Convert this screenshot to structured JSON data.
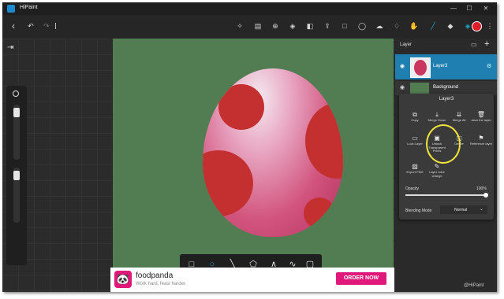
{
  "window": {
    "title": "HiPaint"
  },
  "toolbar": {
    "accent": "#1fa3c9",
    "color_swatch": "#e01e2a",
    "icons": [
      "back-arrow-icon",
      "undo-icon",
      "redo-icon",
      "wand-icon",
      "save-icon",
      "add-icon",
      "fill-icon",
      "adjust-icon",
      "export-icon",
      "square-select-icon",
      "lasso-icon",
      "smudge-icon",
      "drop-icon",
      "hand-icon",
      "brush-icon",
      "eraser-icon",
      "layers-icon",
      "color-swatch-icon",
      "more-icon"
    ]
  },
  "layers_panel": {
    "title": "Layer",
    "layers": [
      {
        "name": "Layer3"
      },
      {
        "name": "Background"
      }
    ]
  },
  "layer_menu": {
    "title": "Layer3",
    "items": [
      {
        "icon": "⧉",
        "label": "Copy"
      },
      {
        "icon": "⤓",
        "label": "Merge Down"
      },
      {
        "icon": "⇊",
        "label": "Merge All"
      },
      {
        "icon": "🗑",
        "label": "clear the layer"
      },
      {
        "icon": "▭",
        "label": "Lock Layer"
      },
      {
        "icon": "▣",
        "label": "Unlock Transparent Pixels"
      },
      {
        "icon": "▢",
        "label": "Delete"
      },
      {
        "icon": "⚑",
        "label": "Reference layer"
      },
      {
        "icon": "▨",
        "label": "Export PNG"
      },
      {
        "icon": "✎",
        "label": "Layer color change"
      }
    ],
    "opacity_label": "Opacity",
    "opacity_value": "100%",
    "opacity_fraction": 1.0,
    "blending_label": "Blending Mode",
    "blending_value": "Normal"
  },
  "ad": {
    "brand": "foodpanda",
    "tagline": "Work hard, feast harder.",
    "cta": "ORDER NOW"
  },
  "watermark": "@HiPaint"
}
